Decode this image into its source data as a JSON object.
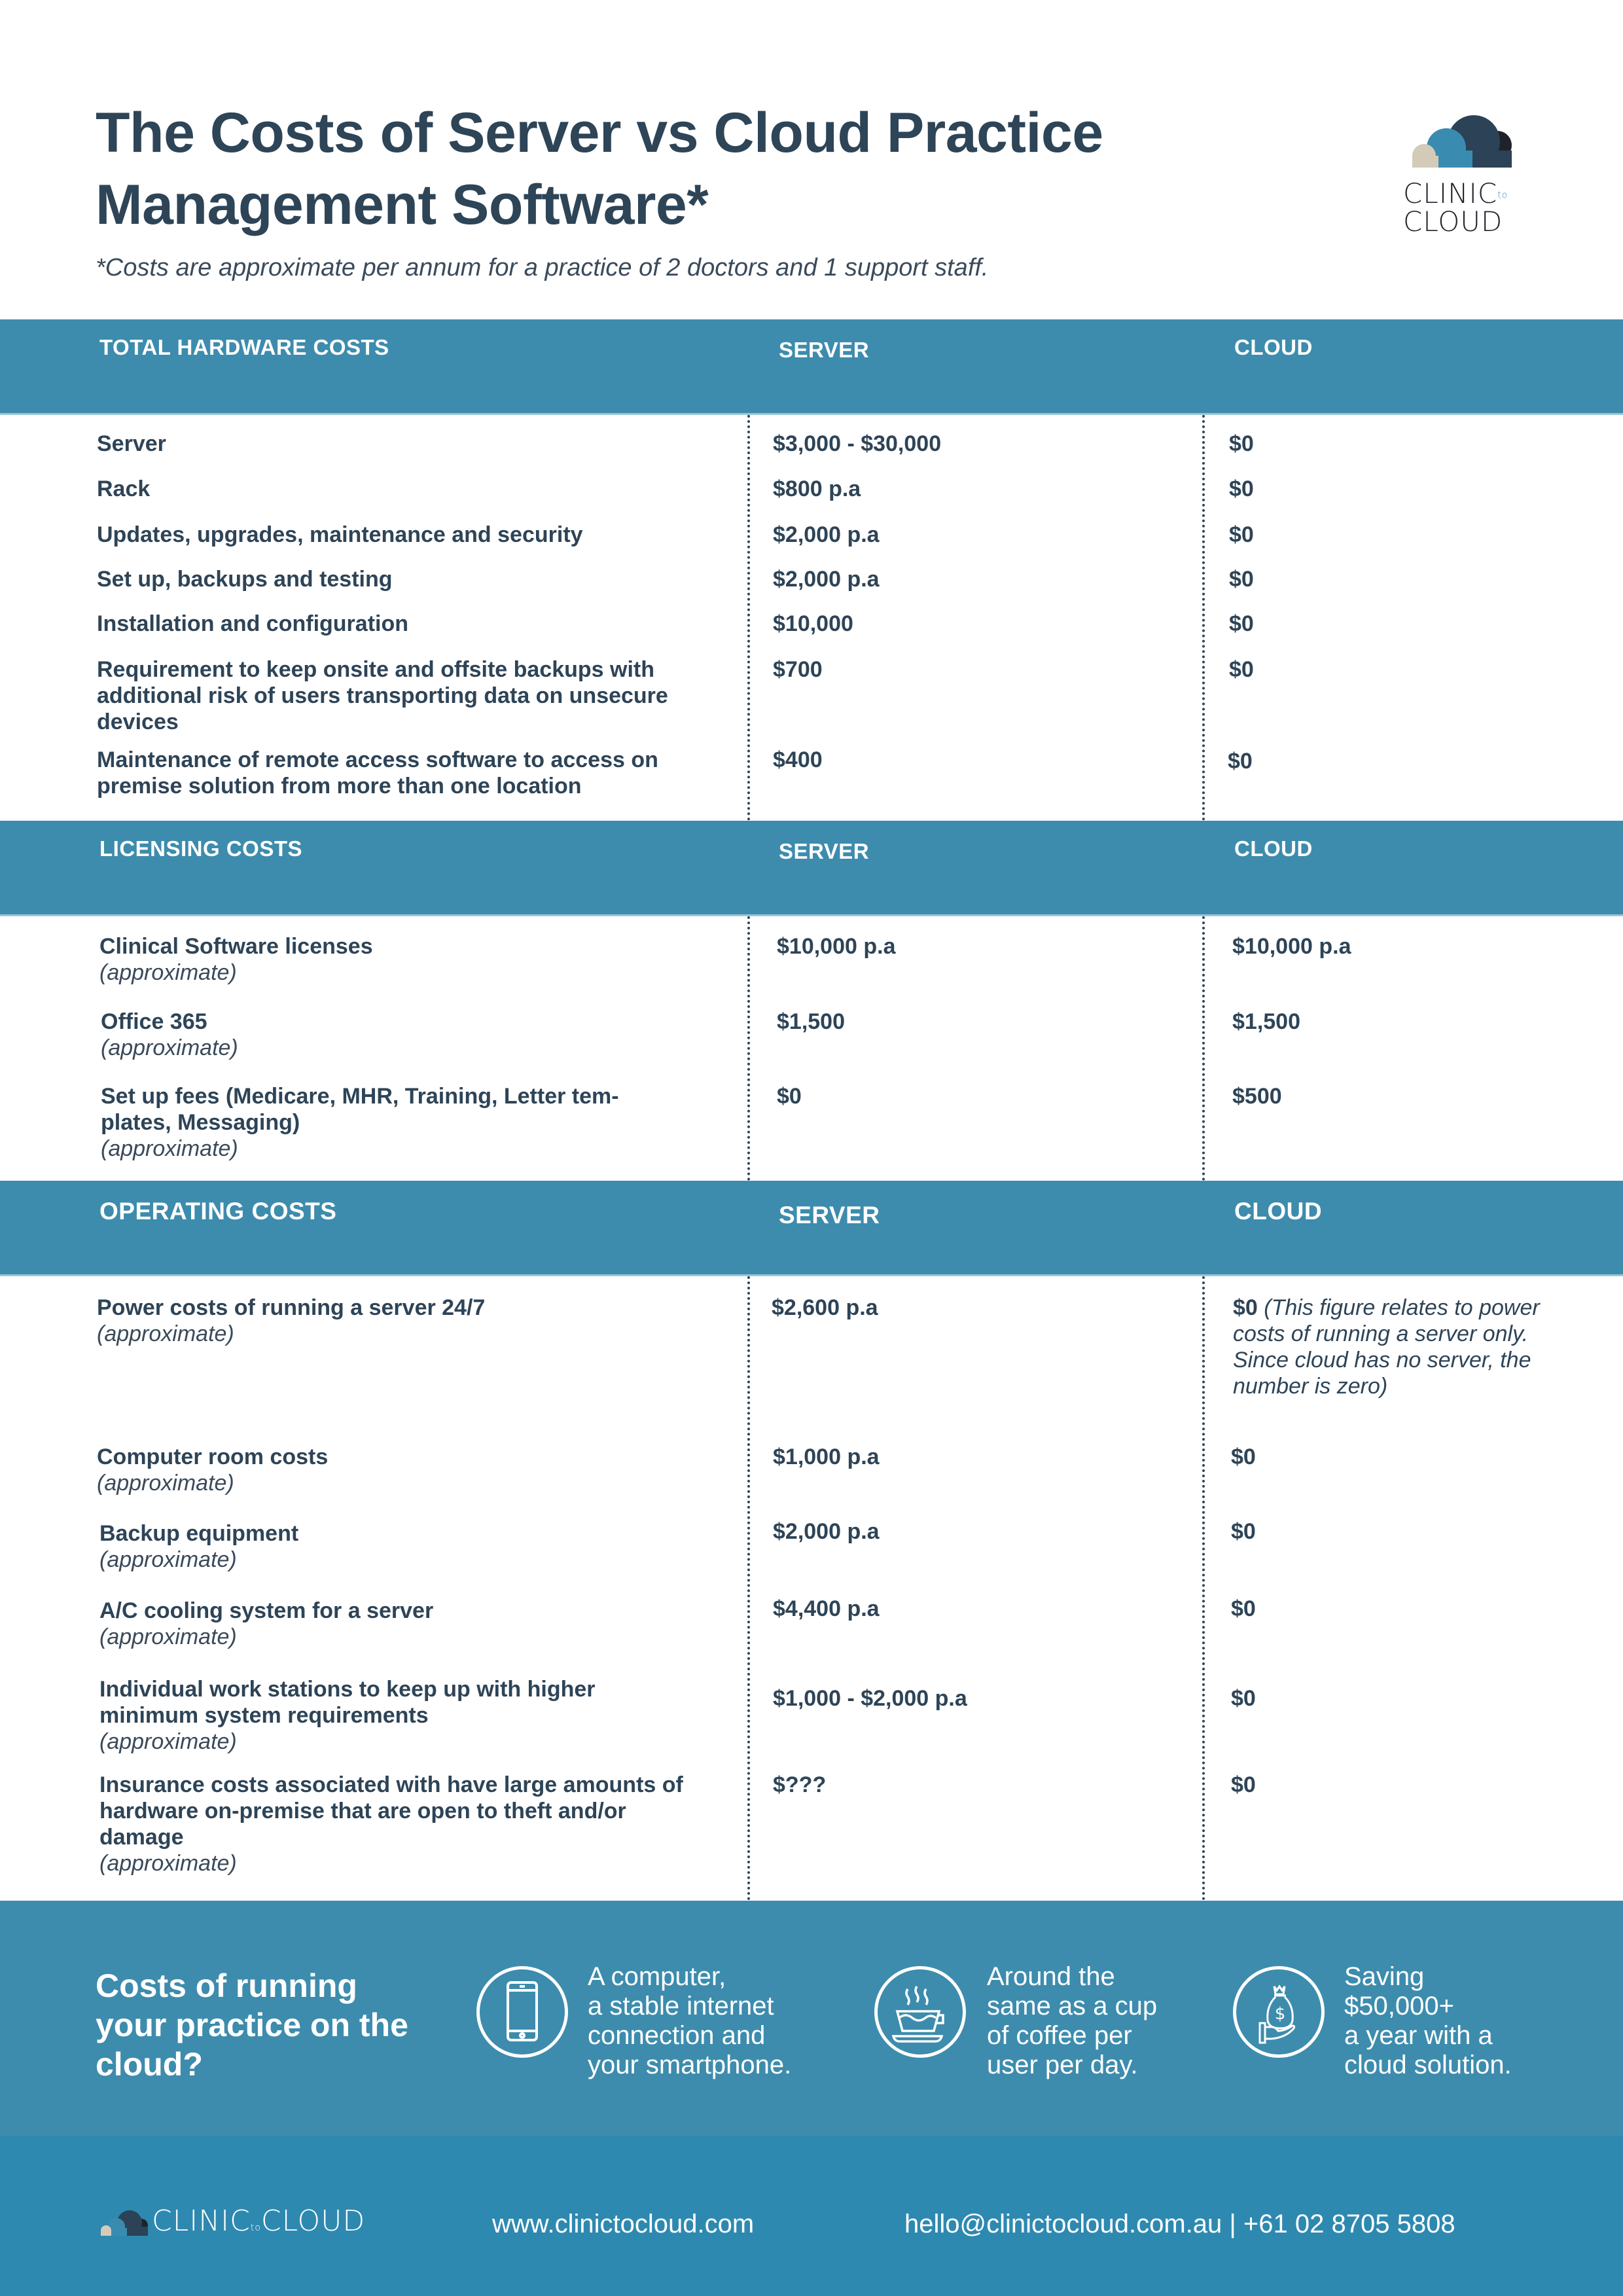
{
  "header": {
    "title": "The Costs of Server vs Cloud Practice Management Software*",
    "subtitle": "*Costs are approximate per annum for a practice of 2 doctors and 1 support staff.",
    "logo": {
      "line1": "CLINIC",
      "to": "to",
      "line2": "CLOUD"
    }
  },
  "colors": {
    "primary_text": "#2e4457",
    "band": "#3d8cad",
    "footer": "#2e89b0",
    "logo_beige": "#d3cbb8",
    "logo_blue": "#3a8bb0",
    "logo_navy": "#2c4256",
    "logo_black": "#1f2329"
  },
  "columns": {
    "server": "SERVER",
    "cloud": "CLOUD"
  },
  "sections": [
    {
      "title": "TOTAL HARDWARE COSTS",
      "rows": [
        {
          "label": "Server",
          "server": "$3,000 - $30,000",
          "cloud": "$0"
        },
        {
          "label": "Rack",
          "server": "$800 p.a",
          "cloud": "$0"
        },
        {
          "label": "Updates, upgrades, maintenance and security",
          "server": "$2,000 p.a",
          "cloud": "$0"
        },
        {
          "label": "Set up, backups and testing",
          "server": "$2,000 p.a",
          "cloud": "$0"
        },
        {
          "label": "Installation and configuration",
          "server": "$10,000",
          "cloud": "$0"
        },
        {
          "label": "Requirement to keep onsite and offsite backups with additional risk of users transporting data on unsecure devices",
          "server": "$700",
          "cloud": "$0"
        },
        {
          "label": "Maintenance of remote access software to access on premise solution from more than one location",
          "server": "$400",
          "cloud": "$0"
        }
      ]
    },
    {
      "title": "LICENSING COSTS",
      "rows": [
        {
          "label": "Clinical Software licenses",
          "note": "(approximate)",
          "server": "$10,000 p.a",
          "cloud": "$10,000 p.a"
        },
        {
          "label": "Office 365",
          "note": "(approximate)",
          "server": "$1,500",
          "cloud": "$1,500"
        },
        {
          "label": "Set up fees (Medicare, MHR, Training, Letter tem-plates, Messaging)",
          "note": "(approximate)",
          "server": "$0",
          "cloud": "$500"
        }
      ]
    },
    {
      "title": "OPERATING COSTS",
      "rows": [
        {
          "label": "Power costs of running a server 24/7",
          "note": "(approximate)",
          "server": "$2,600 p.a",
          "cloud": "$0",
          "cloud_note": "(This figure relates to power costs of running a server only. Since cloud has no server, the number is zero)"
        },
        {
          "label": "Computer room costs",
          "note": "(approximate)",
          "server": "$1,000 p.a",
          "cloud": "$0"
        },
        {
          "label": "Backup equipment",
          "note": "(approximate)",
          "server": "$2,000 p.a",
          "cloud": "$0"
        },
        {
          "label": "A/C cooling system for a server",
          "note": "(approximate)",
          "server": "$4,400 p.a",
          "cloud": "$0"
        },
        {
          "label": "Individual work stations to keep up with higher minimum system requirements",
          "note": "(approximate)",
          "server": "$1,000 - $2,000 p.a",
          "cloud": "$0"
        },
        {
          "label": "Insurance costs associated with have large amounts of hardware on-premise that are open to theft and/or damage",
          "note": "(approximate)",
          "server": "$???",
          "cloud": "$0"
        }
      ]
    }
  ],
  "promo": {
    "title": "Costs of running your practice on the cloud?",
    "items": [
      {
        "icon": "smartphone-icon",
        "text": "A computer,\na stable internet\nconnection and\nyour smartphone."
      },
      {
        "icon": "coffee-cup-icon",
        "text": "Around the\nsame as a cup\nof coffee per\nuser per day."
      },
      {
        "icon": "money-bag-hand-icon",
        "text": "Saving\n$50,000+\na year with a\ncloud solution."
      }
    ]
  },
  "footer": {
    "logo": {
      "line1": "CLINIC",
      "to": "to",
      "line2": "CLOUD"
    },
    "website": "www.clinictocloud.com",
    "contact": "hello@clinictocloud.com.au | +61 02 8705 5808"
  }
}
